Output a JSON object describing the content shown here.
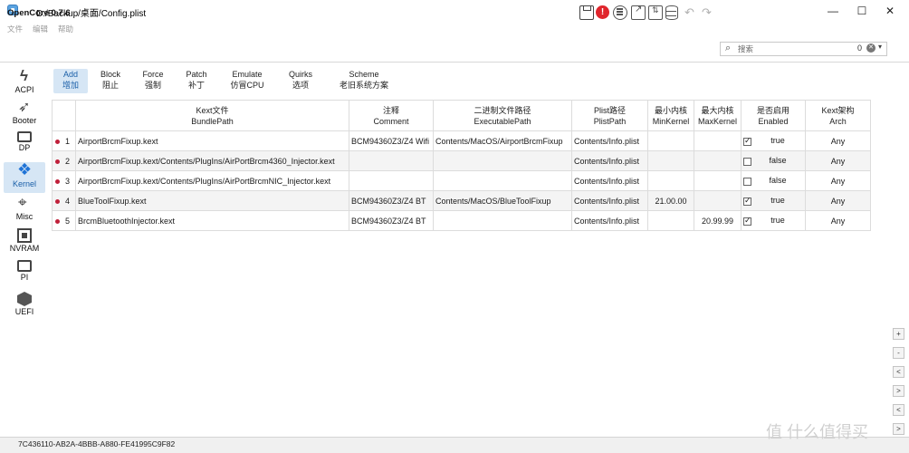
{
  "window": {
    "title": "D:/Backup/桌面/Config.plist",
    "minimize": "—",
    "maximize": "☐",
    "close": "✕"
  },
  "menu": [
    "文件",
    "编辑",
    "帮助"
  ],
  "app_version": "OpenCore 0.7.6",
  "toolbar": {
    "error_glyph": "!",
    "undo_glyph": "↶",
    "redo_glyph": "↷"
  },
  "search": {
    "placeholder": "搜索",
    "count": "0",
    "clear_glyph": "✕",
    "dropdown_glyph": "▾",
    "icon_glyph": "⌕"
  },
  "sidebar": {
    "items": [
      {
        "label": "ACPI",
        "icon": "acpi-icon"
      },
      {
        "label": "Booter",
        "icon": "booter-icon"
      },
      {
        "label": "DP",
        "icon": "dp-icon"
      },
      {
        "label": "Kernel",
        "icon": "kernel-icon",
        "active": true
      },
      {
        "label": "Misc",
        "icon": "misc-icon"
      },
      {
        "label": "NVRAM",
        "icon": "nvram-icon"
      },
      {
        "label": "PI",
        "icon": "pi-icon"
      },
      {
        "label": "UEFI",
        "icon": "uefi-icon"
      }
    ]
  },
  "tabs": [
    {
      "en": "Add",
      "zh": "增加",
      "active": true
    },
    {
      "en": "Block",
      "zh": "阻止"
    },
    {
      "en": "Force",
      "zh": "强制"
    },
    {
      "en": "Patch",
      "zh": "补丁"
    },
    {
      "en": "Emulate",
      "zh": "仿冒CPU"
    },
    {
      "en": "Quirks",
      "zh": "选项"
    },
    {
      "en": "Scheme",
      "zh": "老旧系统方案"
    }
  ],
  "table": {
    "headers": [
      {
        "zh": "",
        "en": ""
      },
      {
        "zh": "Kext文件",
        "en": "BundlePath"
      },
      {
        "zh": "注释",
        "en": "Comment"
      },
      {
        "zh": "二进制文件路径",
        "en": "ExecutablePath"
      },
      {
        "zh": "Plist路径",
        "en": "PlistPath"
      },
      {
        "zh": "最小内核",
        "en": "MinKernel"
      },
      {
        "zh": "最大内核",
        "en": "MaxKernel"
      },
      {
        "zh": "是否启用",
        "en": "Enabled"
      },
      {
        "zh": "Kext架构",
        "en": "Arch"
      }
    ],
    "rows": [
      {
        "num": "1",
        "bundle": "AirportBrcmFixup.kext",
        "comment": "BCM94360Z3/Z4 Wifi",
        "exec": "Contents/MacOS/AirportBrcmFixup",
        "plist": "Contents/Info.plist",
        "min": "",
        "max": "",
        "enabled": true,
        "enabled_text": "true",
        "arch": "Any"
      },
      {
        "num": "2",
        "bundle": "AirportBrcmFixup.kext/Contents/PlugIns/AirPortBrcm4360_Injector.kext",
        "comment": "",
        "exec": "",
        "plist": "Contents/Info.plist",
        "min": "",
        "max": "",
        "enabled": false,
        "enabled_text": "false",
        "arch": "Any"
      },
      {
        "num": "3",
        "bundle": "AirportBrcmFixup.kext/Contents/PlugIns/AirPortBrcmNIC_Injector.kext",
        "comment": "",
        "exec": "",
        "plist": "Contents/Info.plist",
        "min": "",
        "max": "",
        "enabled": false,
        "enabled_text": "false",
        "arch": "Any"
      },
      {
        "num": "4",
        "bundle": "BlueToolFixup.kext",
        "comment": "BCM94360Z3/Z4 BT",
        "exec": "Contents/MacOS/BlueToolFixup",
        "plist": "Contents/Info.plist",
        "min": "21.00.00",
        "max": "",
        "enabled": true,
        "enabled_text": "true",
        "arch": "Any"
      },
      {
        "num": "5",
        "bundle": "BrcmBluetoothInjector.kext",
        "comment": "BCM94360Z3/Z4 BT",
        "exec": "",
        "plist": "Contents/Info.plist",
        "min": "",
        "max": "20.99.99",
        "enabled": true,
        "enabled_text": "true",
        "arch": "Any"
      }
    ]
  },
  "side_buttons": [
    "+",
    "-",
    "<",
    ">",
    "<",
    ">"
  ],
  "status": "7C436110-AB2A-4BBB-A880-FE41995C9F82",
  "watermark": "值 什么值得买",
  "colors": {
    "accent": "#1f73d6",
    "active_bg": "#d6e6f5",
    "row_dot": "#c0203a",
    "error": "#e0252c"
  }
}
